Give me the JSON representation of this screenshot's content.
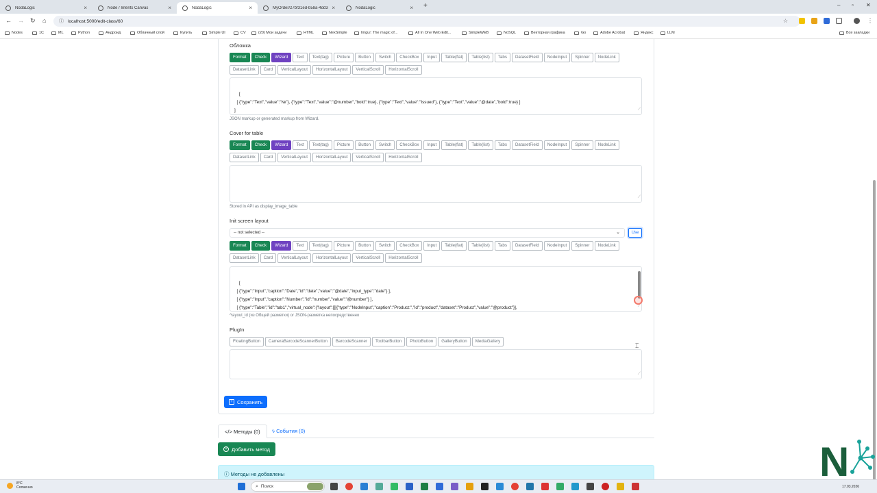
{
  "browser": {
    "tabs": [
      {
        "title": "NodaLogic",
        "active": false
      },
      {
        "title": "Node / Intents Canvas",
        "active": false
      },
      {
        "title": "NodaLogic",
        "active": true
      },
      {
        "title": "MyOrder/27bf31ed-b58a-4dd3",
        "active": false
      },
      {
        "title": "NodaLogic",
        "active": false
      }
    ],
    "url": "localhost:5000/edit-class/60",
    "bookmarks": [
      "Nodes",
      "1C",
      "ML",
      "Python",
      "Андроид",
      "Облачный слой",
      "Купить",
      "Simple UI",
      "CV",
      "(20) Мои задачи",
      "HTML",
      "NexSimple",
      "Imgur: The magic of...",
      "All In One Web Edit...",
      "SimpleWEB",
      "NoSQL",
      "Векторная графика",
      "Go",
      "Adobe Acrobat",
      "Яндекс",
      "LLM"
    ],
    "all_bookmarks": "Все закладки"
  },
  "toolbar_buttons": {
    "row1": [
      "Format",
      "Check",
      "Wizard",
      "Text",
      "Text(tag)",
      "Picture",
      "Button",
      "Switch",
      "CheckBox",
      "Input",
      "Table(flat)",
      "Table(list)",
      "Tabs",
      "DatasetField",
      "NodeInput",
      "Spinner",
      "NodeLink"
    ],
    "row2": [
      "DatasetLink",
      "Card",
      "VerticalLayout",
      "HorizontalLayout",
      "VerticalScroll",
      "HorizontalScroll"
    ]
  },
  "cover": {
    "title": "Обложка",
    "content": "[\n  [ {\"type\":\"Text\",\"value\":\"№\"}, {\"type\":\"Text\",\"value\":\"@number\",\"bold\":true}, {\"type\":\"Text\",\"value\":\"Issued\"}, {\"type\":\"Text\",\"value\":\"@date\",\"bold\":true} ]\n]",
    "hint": "JSON markup or generated markup from Wizard."
  },
  "cover_table": {
    "title": "Cover for table",
    "content": "",
    "hint": "Stored in API as display_image_table"
  },
  "init_screen": {
    "title": "Init screen layout",
    "select_value": "-- not selected --",
    "use_label": "Use",
    "content": "[\n  [ {\"type\":\"Input\",\"caption\":\"Date\",\"id\":\"date\",\"value\":\"@date\",\"input_type\":\"date\"} ],\n  [ {\"type\":\"Input\",\"caption\":\"Number\",\"id\":\"number\",\"value\":\"@number\"} ],\n  [ {\"type\":\"Table\",\"id\":\"tab1\",\"virtual_node\":{\"layout\":[[[{\"type\":\"NodeInput\",\"caption\":\"Product:\",\"id\":\"product\",\"dataset\":\"Product\",\"value\":\"@product\"}],\n[[{\"type\":\"Input\",\"caption\":\"Quantity\",\"id\":\"qty\",\"value\":\"@qty\"}]]],\"cover\":[[[{\"type\":\"NodeLink\",\"value\":\"@product\",\"w\":3},{\"type\":\"Text\",\"value\":\"@qty\",\"w\":1}]]]} ]",
    "hint": "^layout_id (из Общей разметки) or JSON-разметка непосредственно"
  },
  "plugin": {
    "title": "PlugIn",
    "buttons": [
      "FloatingButton",
      "CameraBarcodeScannerButton",
      "BarcodeScanner",
      "ToolbarButton",
      "PhotoButton",
      "GalleryButton",
      "MediaGallery"
    ],
    "content": ""
  },
  "save_label": "Сохранить",
  "page_tabs": {
    "methods": "Методы (0)",
    "events": "События (0)"
  },
  "add_method_label": "Добавить метод",
  "alert_text": "Методы не добавлены",
  "taskbar": {
    "weather_temp": "8°C",
    "weather_desc": "Солнечно",
    "search_placeholder": "Поиск",
    "date": "17.03.2026"
  },
  "colors": {
    "primary": "#0d6efd",
    "success": "#198754",
    "wizard": "#6f42c1",
    "info_bg": "#cff4fc"
  }
}
